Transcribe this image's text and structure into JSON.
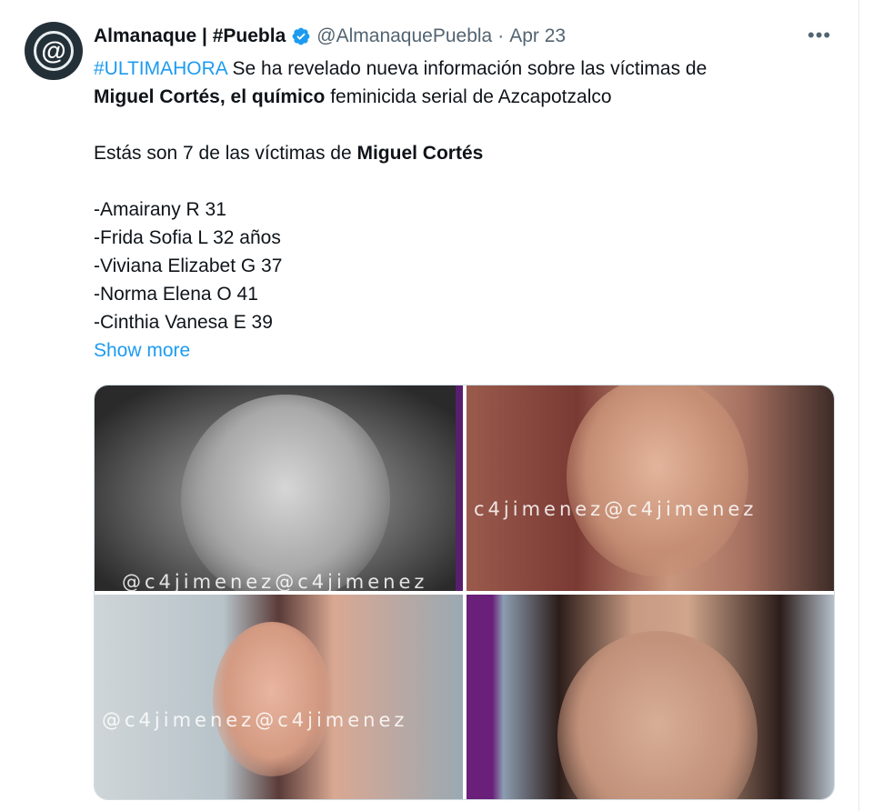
{
  "tweet": {
    "avatar_glyph": "@",
    "author_name": "Almanaque | #Puebla",
    "handle": "@AlmanaquePuebla",
    "separator": "·",
    "date": "Apr 23",
    "more_label": "•••",
    "line1_hashtag": "#ULTIMAHORA",
    "line1_rest": " Se ha revelado nueva información sobre las víctimas de",
    "line2_bold": "Miguel Cortés, el químico",
    "line2_rest": " feminicida serial de Azcapotzalco",
    "line3_text": "Estás son 7 de las víctimas de ",
    "line3_bold": "Miguel Cortés",
    "victims": [
      "-Amairany R 31",
      "-Frida Sofia L 32 años",
      "-Viviana Elizabet G 37",
      "-Norma Elena O 41",
      "-Cinthia Vanesa E 39"
    ],
    "show_more": "Show more"
  },
  "media": {
    "watermarks": [
      "@c4jimenez@c4jimenez",
      "c4jimenez@c4jimenez",
      "@c4jimenez@c4jimenez"
    ]
  },
  "colors": {
    "link": "#1d9bf0",
    "verified": "#1d9bf0",
    "secondary_text": "#536471"
  },
  "icons": {
    "verified": "verified-badge-icon",
    "more": "more-options-icon"
  }
}
